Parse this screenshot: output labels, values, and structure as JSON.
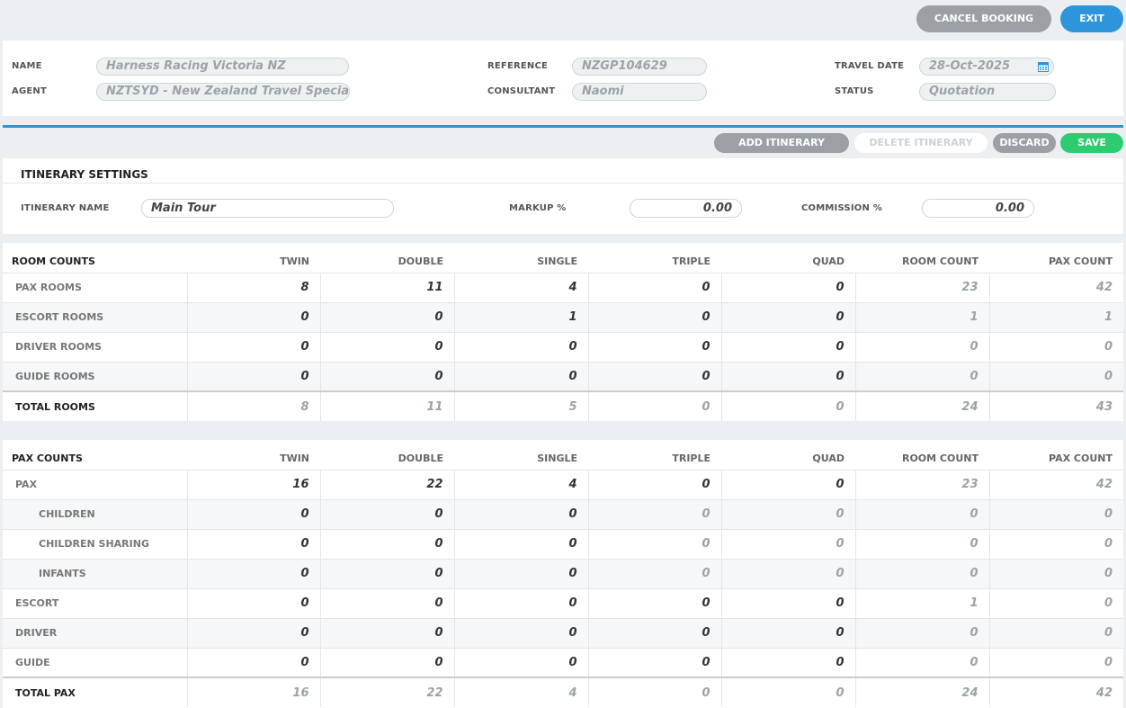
{
  "top_actions": {
    "cancel_label": "CANCEL BOOKING",
    "exit_label": "EXIT"
  },
  "booking": {
    "name_label": "NAME",
    "name_value": "Harness Racing Victoria NZ",
    "agent_label": "AGENT",
    "agent_value": "NZTSYD - New Zealand Travel Specialist",
    "reference_label": "REFERENCE",
    "reference_value": "NZGP104629",
    "consultant_label": "CONSULTANT",
    "consultant_value": "Naomi",
    "travel_date_label": "TRAVEL DATE",
    "travel_date_value": "28-Oct-2025",
    "status_label": "STATUS",
    "status_value": "Quotation"
  },
  "itinerary_actions": {
    "add_label": "ADD ITINERARY",
    "delete_label": "DELETE ITINERARY",
    "discard_label": "DISCARD",
    "save_label": "SAVE"
  },
  "settings": {
    "title": "ITINERARY SETTINGS",
    "itinerary_name_label": "ITINERARY NAME",
    "itinerary_name_value": "Main Tour",
    "markup_label": "MARKUP %",
    "markup_value": "0.00",
    "commission_label": "COMMISSION %",
    "commission_value": "0.00"
  },
  "room_counts": {
    "headers": [
      "ROOM COUNTS",
      "TWIN",
      "DOUBLE",
      "SINGLE",
      "TRIPLE",
      "QUAD",
      "ROOM COUNT",
      "PAX COUNT"
    ],
    "rows": [
      {
        "label": "PAX ROOMS",
        "cells": [
          "8",
          "11",
          "4",
          "0",
          "0",
          "23",
          "42"
        ]
      },
      {
        "label": "ESCORT ROOMS",
        "cells": [
          "0",
          "0",
          "1",
          "0",
          "0",
          "1",
          "1"
        ]
      },
      {
        "label": "DRIVER ROOMS",
        "cells": [
          "0",
          "0",
          "0",
          "0",
          "0",
          "0",
          "0"
        ]
      },
      {
        "label": "GUIDE ROOMS",
        "cells": [
          "0",
          "0",
          "0",
          "0",
          "0",
          "0",
          "0"
        ]
      },
      {
        "label": "TOTAL ROOMS",
        "cells": [
          "8",
          "11",
          "5",
          "0",
          "0",
          "24",
          "43"
        ]
      }
    ]
  },
  "pax_counts": {
    "headers": [
      "PAX COUNTS",
      "TWIN",
      "DOUBLE",
      "SINGLE",
      "TRIPLE",
      "QUAD",
      "ROOM COUNT",
      "PAX COUNT"
    ],
    "rows": [
      {
        "label": "PAX",
        "cells": [
          "16",
          "22",
          "4",
          "0",
          "0",
          "23",
          "42"
        ]
      },
      {
        "label": "CHILDREN",
        "cells": [
          "0",
          "0",
          "0",
          "0",
          "0",
          "0",
          "0"
        ]
      },
      {
        "label": "CHILDREN SHARING",
        "cells": [
          "0",
          "0",
          "0",
          "0",
          "0",
          "0",
          "0"
        ]
      },
      {
        "label": "INFANTS",
        "cells": [
          "0",
          "0",
          "0",
          "0",
          "0",
          "0",
          "0"
        ]
      },
      {
        "label": "ESCORT",
        "cells": [
          "0",
          "0",
          "0",
          "0",
          "0",
          "1",
          "0"
        ]
      },
      {
        "label": "DRIVER",
        "cells": [
          "0",
          "0",
          "0",
          "0",
          "0",
          "0",
          "0"
        ]
      },
      {
        "label": "GUIDE",
        "cells": [
          "0",
          "0",
          "0",
          "0",
          "0",
          "0",
          "0"
        ]
      },
      {
        "label": "TOTAL PAX",
        "cells": [
          "16",
          "22",
          "4",
          "0",
          "0",
          "24",
          "42"
        ]
      }
    ]
  },
  "colors": {
    "accent": "#2e95dc",
    "save": "#2dcc70",
    "muted_button": "#9aa0a3",
    "background": "#eceff1"
  },
  "icons": {
    "calendar": "calendar-icon"
  }
}
